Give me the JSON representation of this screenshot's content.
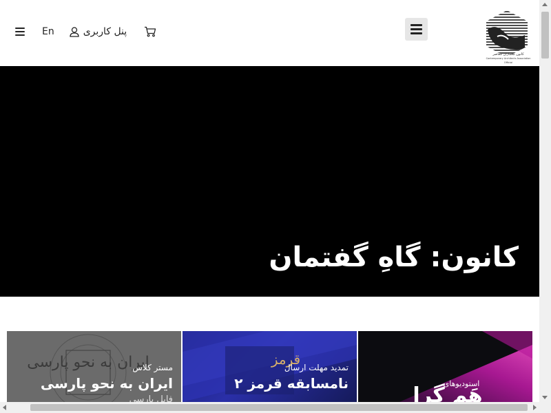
{
  "header": {
    "lang_label": "En",
    "user_panel_label": "پنل کاربری",
    "logo_caption_fa": "کانون معماران معاصر",
    "logo_caption_en": "Contemporary Architects Association Official"
  },
  "hero": {
    "title": "کانون: گاهِ گفتمان",
    "background": "#000000"
  },
  "cards": [
    {
      "tag": "مستر کلاس",
      "title": "ایران به نحو پارسی",
      "subtitle": "فایل پارسی",
      "art_text": "ایران به نحو پارسی"
    },
    {
      "tag": "تمدید مهلت ارسال",
      "title": "نامسابقه قرمز ۲",
      "subtitle": "",
      "art_text": "قرمز"
    },
    {
      "tag": "",
      "title": "",
      "subtitle": "",
      "art_label": "استودیوهای",
      "art_text": "هَم گرا"
    }
  ],
  "colors": {
    "menu_button_bg": "#e6e6e6",
    "text_dark": "#222222",
    "card1_bg": "#6e6e6e",
    "card2_bg": "#2a2fa8",
    "card3_bg": "#0c0c10"
  },
  "icons": {
    "hamburger": "hamburger-icon",
    "user": "user-icon",
    "cart": "cart-icon",
    "menu": "menu-icon"
  }
}
